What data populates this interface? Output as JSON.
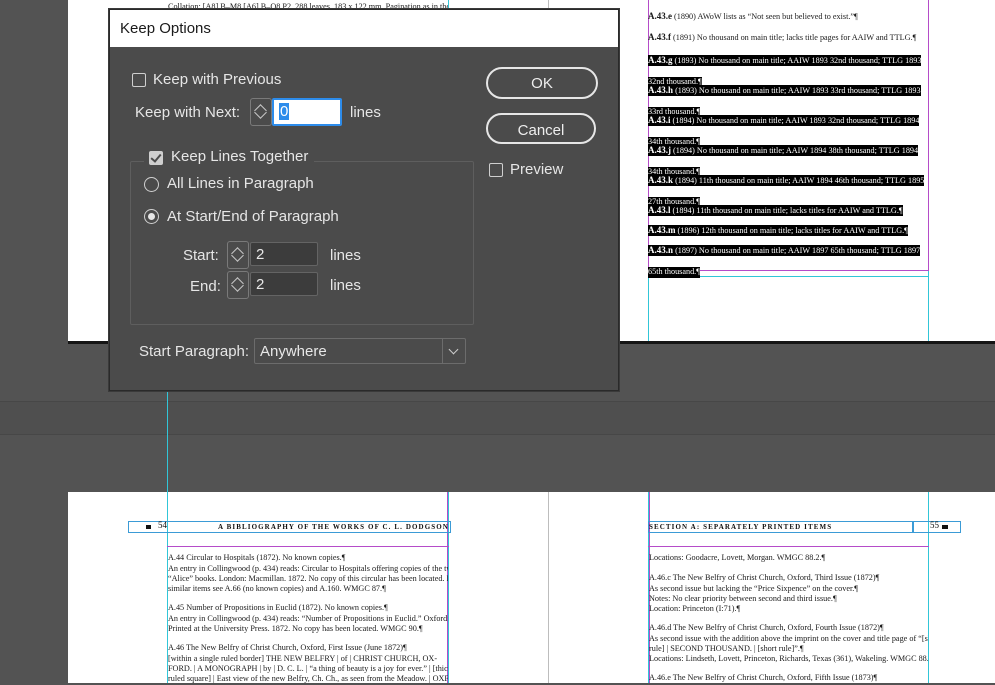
{
  "dialog": {
    "title": "Keep Options",
    "keep_with_previous": {
      "label": "Keep with Previous",
      "checked": false
    },
    "keep_with_next": {
      "label": "Keep with Next:",
      "value": "0",
      "unit": "lines"
    },
    "keep_lines_together": {
      "label": "Keep Lines Together",
      "checked": true
    },
    "all_lines": {
      "label": "All Lines in Paragraph",
      "selected": false
    },
    "at_start_end": {
      "label": "At Start/End of Paragraph",
      "selected": true
    },
    "start": {
      "label": "Start:",
      "value": "2",
      "unit": "lines"
    },
    "end": {
      "label": "End:",
      "value": "2",
      "unit": "lines"
    },
    "start_paragraph": {
      "label": "Start Paragraph:",
      "value": "Anywhere"
    },
    "ok_label": "OK",
    "cancel_label": "Cancel",
    "preview": {
      "label": "Preview",
      "checked": false
    }
  },
  "top_left_page": {
    "lines": [
      "Collation: [A8] B–M8 [A6] B–O8 P2. 288 leaves. 183 x 122 mm. Pagination as in the"
    ]
  },
  "top_right_page": {
    "entries": [
      {
        "id": "A.43.e",
        "text": " (1890) AWoW lists as “Not seen but believed to exist.”¶",
        "highlighted": false
      },
      {
        "id": "A.43.f",
        "text": " (1891) No thousand on main title; lacks title pages for AAIW and TTLG.¶",
        "highlighted": false
      },
      {
        "id": "A.43.g",
        "text": " (1893) No thousand on main title; AAIW 1893 32nd thousand; TTLG 1893",
        "cont": "32nd thousand.¶",
        "highlighted": true
      },
      {
        "id": "A.43.h",
        "text": " (1893) No thousand on main title; AAIW 1893 33rd thousand; TTLG 1893",
        "cont": "33rd thousand.¶",
        "highlighted": true
      },
      {
        "id": "A.43.i",
        "text": " (1894) No thousand on main title; AAIW 1893 32nd thousand; TTLG 1894",
        "cont": "34th thousand.¶",
        "highlighted": true
      },
      {
        "id": "A.43.j",
        "text": " (1894) No thousand on main title; AAIW 1894 38th thousand; TTLG 1894",
        "cont": "34th thousand.¶",
        "highlighted": true
      },
      {
        "id": "A.43.k",
        "text": " (1894) 11th thousand on main title; AAIW 1894 46th thousand; TTLG 1895",
        "cont": "27th thousand.¶",
        "highlighted": true
      },
      {
        "id": "A.43.l",
        "text": " (1894) 11th thousand on main title; lacks titles for AAIW and TTLG.¶",
        "highlighted": true
      },
      {
        "id": "A.43.m",
        "text": " (1896) 12th thousand on main title; lacks titles for AAIW and TTLG.¶",
        "highlighted": true
      },
      {
        "id": "A.43.n",
        "text": " (1897) No thousand on main title; AAIW 1897 65th thousand; TTLG 1897",
        "cont": "65th thousand.¶",
        "highlighted": true
      }
    ]
  },
  "bottom_left_page": {
    "page_number": "54",
    "running_head": "A BIBLIOGRAPHY OF THE WORKS OF C. L. DODGSON",
    "lines": [
      "A.44 Circular to Hospitals (1872). No known copies.¶",
      "An entry in Collingwood (p. 434) reads: Circular to Hospitals offering copies of the two",
      "“Alice” books. London: Macmillan. 1872. No copy of this circular has been located. For",
      "similar items see A.66 (no known copies) and A.160. WMGC 87.¶",
      "A.45 Number of Propositions in Euclid (1872). No known copies.¶",
      "An entry in Collingwood (p. 434) reads: “Number of Propositions in Euclid.” Oxford:",
      "Printed at the University Press. 1872. No copy has been located. WMGC 90.¶",
      "A.46 The New Belfry of Christ Church, Oxford, First Issue (June 1872)¶",
      "[within a single ruled border] THE NEW BELFRY | of | CHRIST CHURCH, OX-",
      "FORD. | A MONOGRAPH | by | D. C. L. | “a thing of beauty is a joy for ever.” | [thick",
      "ruled square] | East view of the new Belfry, Ch. Ch., as seen from the Meadow. | OXFORD:"
    ]
  },
  "bottom_right_page": {
    "page_number": "55",
    "running_head": "SECTION A: SEPARATELY PRINTED ITEMS",
    "lines": [
      "Locations: Goodacre, Lovett, Morgan. WMGC 88.2.¶",
      "A.46.c The New Belfry of Christ Church, Oxford, Third Issue (1872)¶",
      "As second issue but lacking the “Price Sixpence” on the cover.¶",
      "Notes: No clear priority between second and third issue.¶",
      "Location: Princeton (I:71).¶",
      "A.46.d The New Belfry of Christ Church, Oxford, Fourth Issue (1872)¶",
      "As second issue with the addition above the imprint on the cover and title page of “[short",
      "rule] | SECOND THOUSAND. | [short rule]”.¶",
      "Locations: Lindseth, Lovett, Princeton, Richards, Texas (361), Wakeling. WMGC 88.3.¶",
      "A.46.e The New Belfry of Christ Church, Oxford, Fifth Issue (1873)¶"
    ]
  },
  "colors": {
    "pasteboard": "#535353",
    "dialog_bg": "#4b4b4b",
    "guide_cyan": "#31c6d8",
    "margin_magenta": "#b54cc9",
    "focus_blue": "#2d8ceb"
  }
}
